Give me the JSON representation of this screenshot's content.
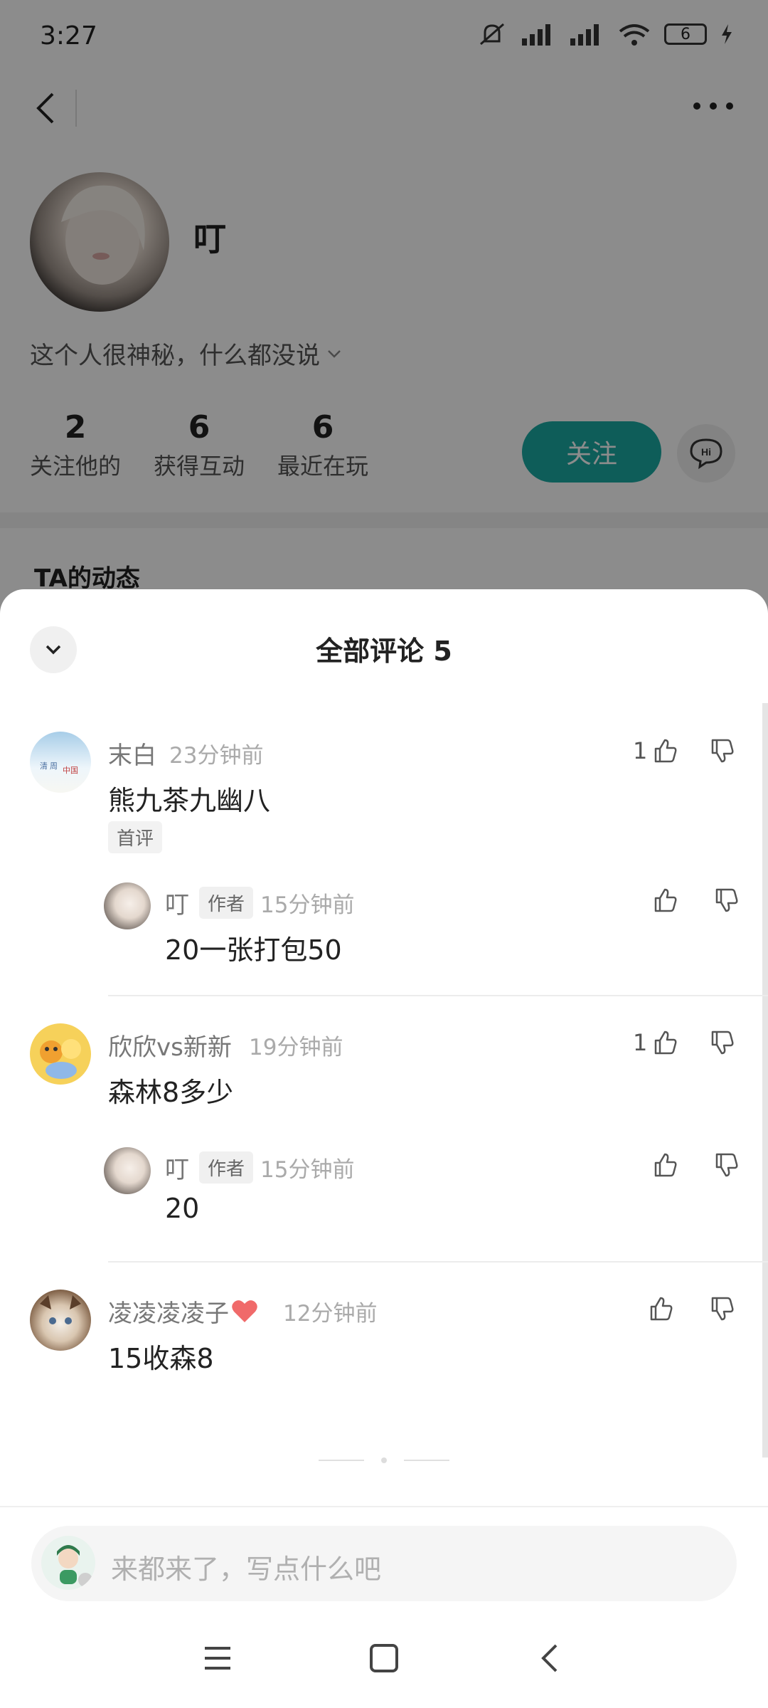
{
  "status_bar": {
    "time": "3:27",
    "battery": "6"
  },
  "profile": {
    "name": "叮",
    "bio": "这个人很神秘，什么都没说",
    "stats": [
      {
        "value": "2",
        "label": "关注他的"
      },
      {
        "value": "6",
        "label": "获得互动"
      },
      {
        "value": "6",
        "label": "最近在玩"
      }
    ],
    "follow_label": "关注",
    "hi_label": "Hi",
    "feed_title": "TA的动态"
  },
  "sheet": {
    "title": "全部评论 5"
  },
  "comments": [
    {
      "name": "末白",
      "time": "23分钟前",
      "text": "熊九茶九幽八",
      "tag": "首评",
      "likes": "1",
      "reply": {
        "name": "叮",
        "author_tag": "作者",
        "time": "15分钟前",
        "text": "20一张打包50"
      }
    },
    {
      "name": "欣欣vs新新",
      "time": "19分钟前",
      "text": "森林8多少",
      "likes": "1",
      "reply": {
        "name": "叮",
        "author_tag": "作者",
        "time": "15分钟前",
        "text": "20"
      }
    },
    {
      "name": "凌凌凌凌子",
      "time": "12分钟前",
      "text": "15收森8",
      "likes": ""
    }
  ],
  "input": {
    "placeholder": "来都来了，写点什么吧"
  },
  "icons": {
    "back": "back-arrow-icon",
    "more": "more-dots-icon",
    "collapse": "chevron-down-icon",
    "like": "thumbs-up-icon",
    "dislike": "thumbs-down-icon",
    "heart": "heart-icon",
    "menu": "menu-icon",
    "home": "home-square-icon",
    "sys_back": "sys-back-icon"
  },
  "colors": {
    "accent": "#1aa9a3",
    "heart": "#f06a6a"
  }
}
